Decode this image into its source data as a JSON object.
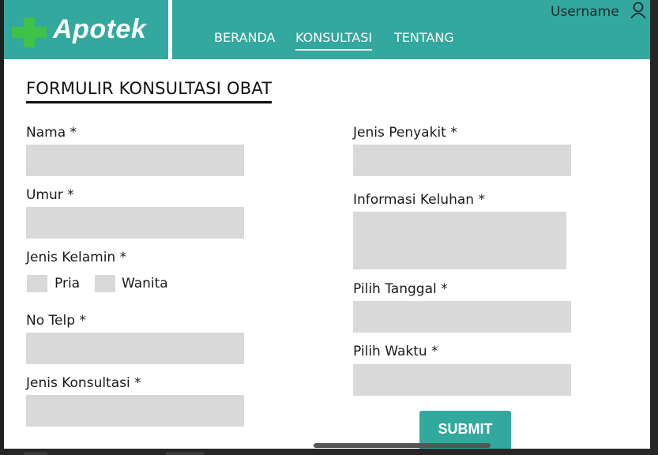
{
  "app": {
    "logo_text": "Apotek",
    "brand_color": "#33a89e",
    "logo_color": "#3fc14a"
  },
  "nav": {
    "items": [
      {
        "label": "BERANDA",
        "active": false
      },
      {
        "label": "KONSULTASI",
        "active": true
      },
      {
        "label": "TENTANG",
        "active": false
      }
    ]
  },
  "user": {
    "name": "Username",
    "icon": "user-icon"
  },
  "form": {
    "title": "FORMULIR KONSULTASI OBAT",
    "left": {
      "nama_label": "Nama *",
      "umur_label": "Umur *",
      "kelamin_label": "Jenis Kelamin *",
      "pria_label": "Pria",
      "wanita_label": "Wanita",
      "telp_label": "No Telp *",
      "jenis_konsultasi_label": "Jenis Konsultasi *"
    },
    "right": {
      "penyakit_label": "Jenis Penyakit *",
      "keluhan_label": "Informasi Keluhan *",
      "tanggal_label": "Pilih Tanggal *",
      "waktu_label": "Pilih Waktu *"
    },
    "submit_label": "SUBMIT"
  }
}
